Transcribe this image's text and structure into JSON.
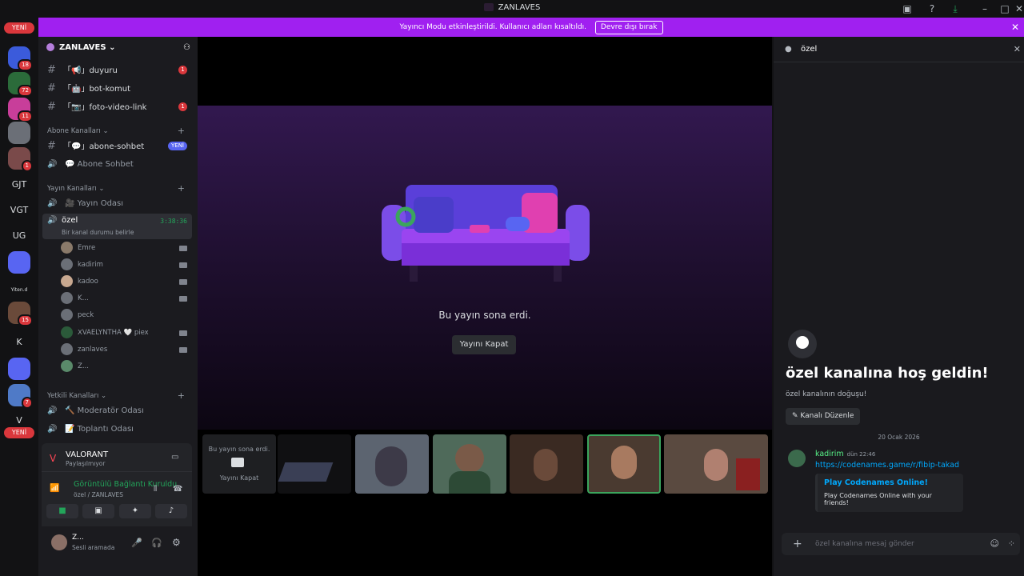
{
  "window": {
    "title": "ZANLAVES"
  },
  "banner": {
    "text": "Yayıncı Modu etkinleştirildi. Kullanıcı adları kısaltıldı.",
    "button": "Devre dışı bırak"
  },
  "guilds": {
    "new_label_top": "YENİ",
    "new_label_bottom": "YENİ",
    "items": [
      {
        "label": "",
        "badge": "18"
      },
      {
        "label": "",
        "badge": "72"
      },
      {
        "label": "",
        "badge": "11"
      },
      {
        "label": "",
        "badge": ""
      },
      {
        "label": "",
        "badge": "1"
      },
      {
        "label": "GJT",
        "badge": ""
      },
      {
        "label": "VGT",
        "badge": ""
      },
      {
        "label": "UG",
        "badge": ""
      },
      {
        "label": "",
        "badge": ""
      },
      {
        "label": "Yiten.d",
        "badge": ""
      },
      {
        "label": "",
        "badge": "15"
      },
      {
        "label": "K",
        "badge": ""
      },
      {
        "label": "",
        "badge": ""
      },
      {
        "label": "",
        "badge": "7"
      },
      {
        "label": "V",
        "badge": ""
      }
    ]
  },
  "server": {
    "name": "ZANLAVES"
  },
  "channels": {
    "top": [
      {
        "name": "「📢」duyuru",
        "badge": "1"
      },
      {
        "name": "「🤖」bot-komut",
        "badge": ""
      },
      {
        "name": "「📷」foto-video-link",
        "badge": "1"
      }
    ],
    "cat_abone": "Abone Kanalları",
    "abone": [
      {
        "name": "「💬」abone-sohbet",
        "tag": "YENİ"
      },
      {
        "name": "💬 Abone Sohbet"
      }
    ],
    "cat_yayin": "Yayın Kanalları",
    "yayin_odasi": "🎥 Yayın Odası",
    "ozel": {
      "name": "özel",
      "timer": "3:38:36",
      "status": "Bir kanal durumu belirle"
    },
    "users": [
      "Emre",
      "kadirim",
      "kadoo",
      "K...",
      "peck",
      "ꓫVAELYNTHA 🤍 piex",
      "zanlaves",
      "Z..."
    ],
    "cat_yetkili": "Yetkili Kanalları",
    "yetkili": [
      "🔨 Moderatör Odası",
      "📝 Toplantı Odası"
    ]
  },
  "panel": {
    "activity_title": "VALORANT",
    "activity_sub": "Paylaşılmıyor",
    "conn_title": "Görüntülü Bağlantı Kuruldu",
    "conn_sub": "özel / ZANLAVES",
    "user_name": "Z...",
    "user_status": "Sesli aramada"
  },
  "stage": {
    "ended_text": "Bu yayın sona erdi.",
    "close_button": "Yayını Kapat"
  },
  "strip": {
    "tile_text": "Bu yayın sona erdi.",
    "tile_button": "Yayını Kapat"
  },
  "chat": {
    "channel": "özel",
    "welcome_title": "özel kanalına hoş geldin!",
    "welcome_sub": "özel kanalının doğuşu!",
    "edit_button": "Kanalı Düzenle",
    "date": "20 Ocak 2026",
    "message": {
      "author": "kadirim",
      "time": "dün 22:46",
      "link": "https://codenames.game/r/fibip-takad",
      "embed_title": "Play Codenames Online!",
      "embed_desc": "Play Codenames Online with your friends!"
    },
    "input_placeholder": "özel kanalına mesaj gönder"
  },
  "colors": {
    "accent": "#a020f0",
    "link": "#00a8fc",
    "green": "#57f287",
    "danger": "#da373c"
  }
}
